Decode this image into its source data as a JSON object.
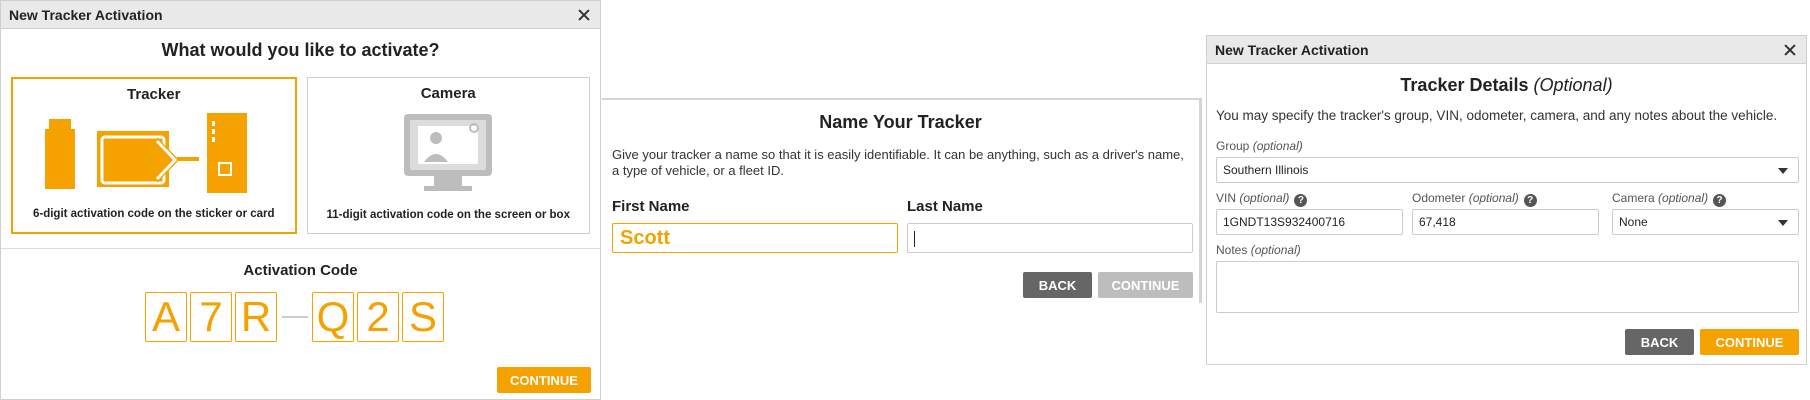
{
  "dialog1": {
    "title": "New Tracker Activation",
    "question": "What would you like to activate?",
    "options": [
      {
        "title": "Tracker",
        "caption": "6-digit activation code on the sticker or card"
      },
      {
        "title": "Camera",
        "caption": "11-digit activation code on the screen or box"
      }
    ],
    "selected_option": "Tracker",
    "activation_code_label": "Activation Code",
    "code_chars": [
      "A",
      "7",
      "R",
      "Q",
      "2",
      "S"
    ],
    "continue_label": "CONTINUE"
  },
  "dialog2": {
    "heading": "Name Your Tracker",
    "description": "Give your tracker a name so that it is easily identifiable. It can be anything, such as a driver's name, a type of vehicle, or a fleet ID.",
    "first_name_label": "First Name",
    "first_name_value": "Scott",
    "last_name_label": "Last Name",
    "last_name_value": "",
    "back_label": "BACK",
    "continue_label": "CONTINUE"
  },
  "dialog3": {
    "title": "New Tracker Activation",
    "heading": "Tracker Details",
    "heading_suffix": "(Optional)",
    "description": "You may specify the tracker's group, VIN, odometer, camera, and any notes about the vehicle.",
    "group_label": "Group",
    "group_value": "Southern Illinois",
    "vin_label": "VIN",
    "vin_value": "1GNDT13S932400716",
    "odometer_label": "Odometer",
    "odometer_value": "67,418",
    "camera_label": "Camera",
    "camera_value": "None",
    "notes_label": "Notes",
    "optional_tag": "(optional)",
    "help_glyph": "?",
    "back_label": "BACK",
    "continue_label": "CONTINUE"
  },
  "colors": {
    "accent": "#f5a100",
    "button_dark": "#666666",
    "button_disabled": "#bdbdbd"
  }
}
